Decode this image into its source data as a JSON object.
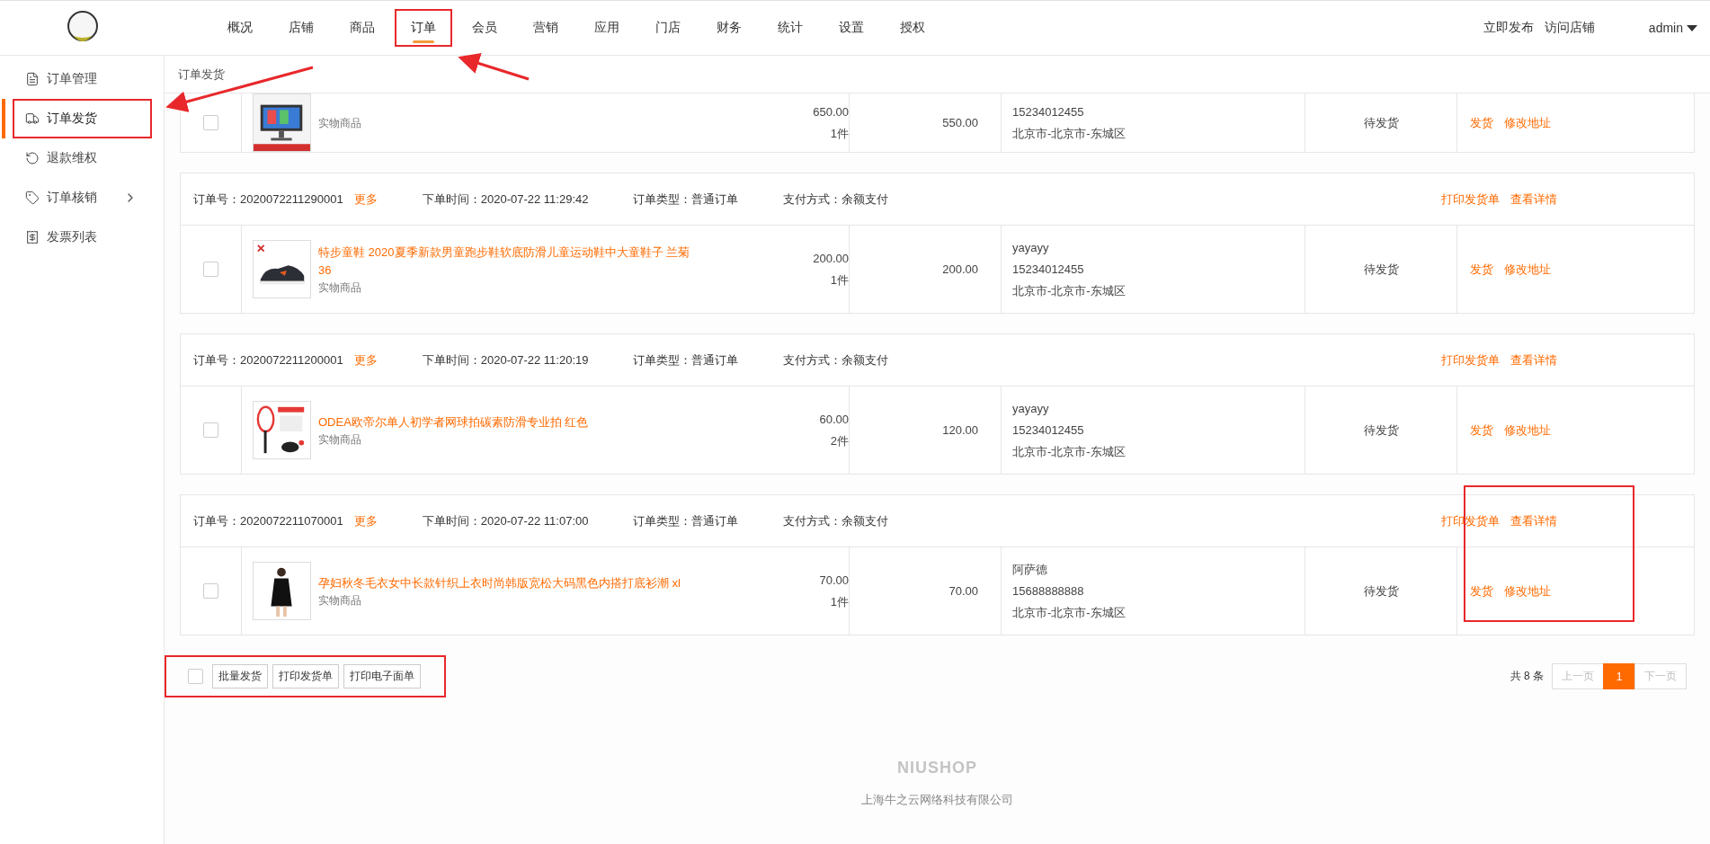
{
  "header": {
    "nav": [
      {
        "label": "概况",
        "selected": false,
        "highlighted": false
      },
      {
        "label": "店铺",
        "selected": false,
        "highlighted": false
      },
      {
        "label": "商品",
        "selected": false,
        "highlighted": false
      },
      {
        "label": "订单",
        "selected": true,
        "highlighted": true
      },
      {
        "label": "会员",
        "selected": false,
        "highlighted": false
      },
      {
        "label": "营销",
        "selected": false,
        "highlighted": false
      },
      {
        "label": "应用",
        "selected": false,
        "highlighted": false
      },
      {
        "label": "门店",
        "selected": false,
        "highlighted": false
      },
      {
        "label": "财务",
        "selected": false,
        "highlighted": false
      },
      {
        "label": "统计",
        "selected": false,
        "highlighted": false
      },
      {
        "label": "设置",
        "selected": false,
        "highlighted": false
      },
      {
        "label": "授权",
        "selected": false,
        "highlighted": false
      }
    ],
    "links": [
      "立即发布",
      "访问店铺"
    ],
    "user": "admin"
  },
  "sidebar": {
    "items": [
      {
        "kind": "link",
        "label": "订单管理",
        "selected": false,
        "highlighted": false
      },
      {
        "kind": "link",
        "label": "订单发货",
        "selected": true,
        "highlighted": true
      },
      {
        "kind": "link",
        "label": "退款维权",
        "selected": false,
        "highlighted": false
      },
      {
        "kind": "group",
        "label": "订单核销",
        "selected": false,
        "highlighted": false,
        "expanded": false
      },
      {
        "kind": "link",
        "label": "发票列表",
        "selected": false,
        "highlighted": false
      }
    ]
  },
  "breadcrumb": "订单发货",
  "orders": [
    {
      "checked": false,
      "highlighted": false,
      "product": {
        "type": "实物商品"
      },
      "price": "650.00",
      "quantity": "1件",
      "total": "550.00",
      "buyer": {
        "phone": "15234012455",
        "address": "北京市-北京市-东城区"
      },
      "status": "待发货",
      "actions": [
        "发货",
        "修改地址"
      ]
    },
    {
      "checked": false,
      "highlighted": false,
      "header": {
        "order_no": "订单号：2020072211290001",
        "more": "更多",
        "time": "下单时间：2020-07-22 11:29:42",
        "type": "订单类型：普通订单",
        "payment": "支付方式：余额支付",
        "links": [
          "打印发货单",
          "查看详情"
        ]
      },
      "product": {
        "title": "特步童鞋 2020夏季新款男童跑步鞋软底防滑儿童运动鞋中大童鞋子 兰菊 36",
        "type": "实物商品"
      },
      "price": "200.00",
      "quantity": "1件",
      "total": "200.00",
      "buyer": {
        "name": "yayayy",
        "phone": "15234012455",
        "address": "北京市-北京市-东城区"
      },
      "status": "待发货",
      "actions": [
        "发货",
        "修改地址"
      ]
    },
    {
      "checked": false,
      "highlighted": false,
      "header": {
        "order_no": "订单号：2020072211200001",
        "more": "更多",
        "time": "下单时间：2020-07-22 11:20:19",
        "type": "订单类型：普通订单",
        "payment": "支付方式：余额支付",
        "links": [
          "打印发货单",
          "查看详情"
        ]
      },
      "product": {
        "title": "ODEA欧帝尔单人初学者网球拍碳素防滑专业拍 红色",
        "type": "实物商品"
      },
      "price": "60.00",
      "quantity": "2件",
      "total": "120.00",
      "buyer": {
        "name": "yayayy",
        "phone": "15234012455",
        "address": "北京市-北京市-东城区"
      },
      "status": "待发货",
      "actions": [
        "发货",
        "修改地址"
      ]
    },
    {
      "checked": false,
      "highlighted": true,
      "header": {
        "order_no": "订单号：2020072211070001",
        "more": "更多",
        "time": "下单时间：2020-07-22 11:07:00",
        "type": "订单类型：普通订单",
        "payment": "支付方式：余额支付",
        "links": [
          "打印发货单",
          "查看详情"
        ]
      },
      "product": {
        "title": "孕妇秋冬毛衣女中长款针织上衣时尚韩版宽松大码黑色内搭打底衫潮 xl",
        "type": "实物商品"
      },
      "price": "70.00",
      "quantity": "1件",
      "total": "70.00",
      "buyer": {
        "name": "阿萨德",
        "phone": "15688888888",
        "address": "北京市-北京市-东城区"
      },
      "status": "待发货",
      "actions": [
        "发货",
        "修改地址"
      ]
    }
  ],
  "batch_bar": {
    "checked": false,
    "highlighted": true,
    "buttons": [
      "批量发货",
      "打印发货单",
      "打印电子面单"
    ]
  },
  "pagination": {
    "total": "共 8 条",
    "prev": {
      "label": "上一页",
      "disabled": true
    },
    "pages": [
      {
        "label": "1",
        "selected": true
      }
    ],
    "next": {
      "label": "下一页",
      "disabled": true
    }
  },
  "footer": {
    "logo": "NIUSHOP",
    "company": "上海牛之云网络科技有限公司"
  }
}
